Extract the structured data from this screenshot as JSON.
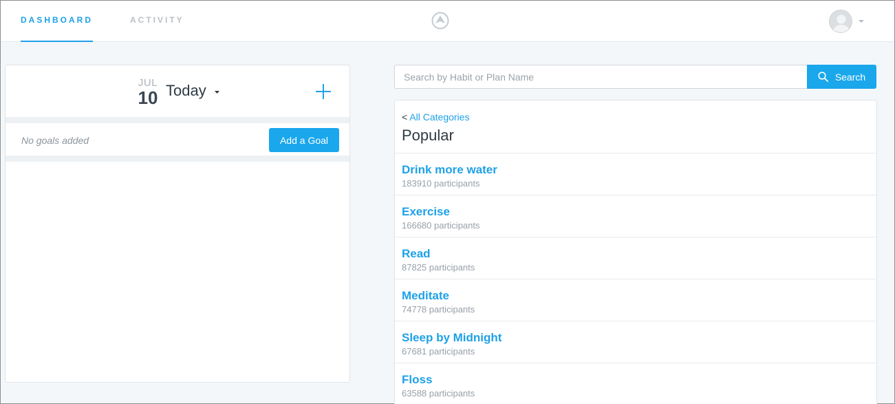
{
  "nav": {
    "tabs": [
      {
        "label": "DASHBOARD",
        "active": true
      },
      {
        "label": "ACTIVITY",
        "active": false
      }
    ],
    "logo_icon": "triangle-circle-logo",
    "avatar_icon": "user-avatar",
    "menu_icon": "chevron-down-icon"
  },
  "goals": {
    "month": "JUL",
    "day": "10",
    "day_label": "Today",
    "empty_text": "No goals added",
    "add_goal_label": "Add a Goal",
    "add_icon": "plus-icon"
  },
  "search": {
    "placeholder": "Search by Habit or Plan Name",
    "button_label": "Search",
    "icon": "search-icon"
  },
  "categories": {
    "back_prefix": "< ",
    "back_label": "All Categories",
    "title": "Popular",
    "participants_suffix": "participants",
    "habits": [
      {
        "name": "Drink more water",
        "participants": "183910"
      },
      {
        "name": "Exercise",
        "participants": "166680"
      },
      {
        "name": "Read",
        "participants": "87825"
      },
      {
        "name": "Meditate",
        "participants": "74778"
      },
      {
        "name": "Sleep by Midnight",
        "participants": "67681"
      },
      {
        "name": "Floss",
        "participants": "63588"
      }
    ]
  },
  "colors": {
    "accent": "#1ea1e8",
    "button": "#1aa7ec",
    "background": "#f4f7fa"
  }
}
